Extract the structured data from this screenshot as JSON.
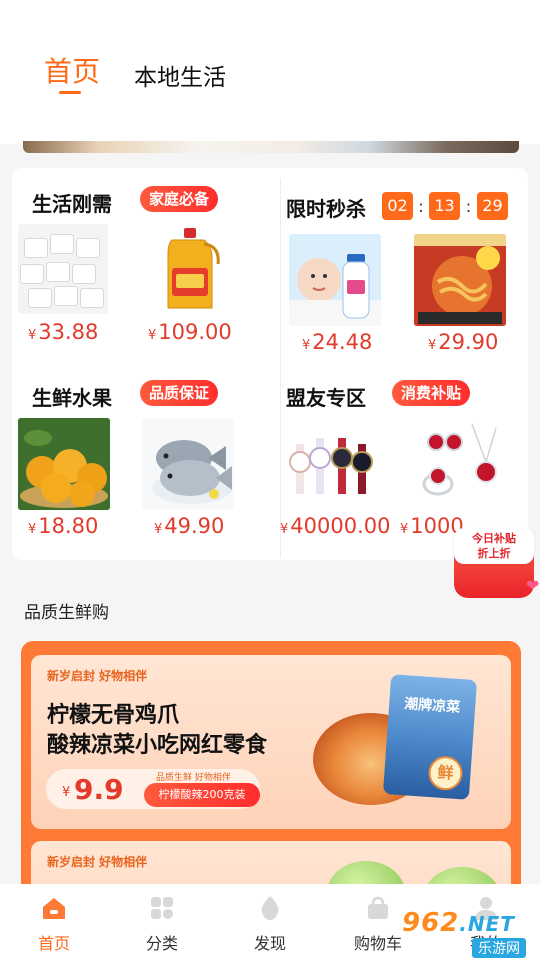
{
  "header": {
    "tabs": [
      {
        "label": "首页",
        "active": true
      },
      {
        "label": "本地生活",
        "active": false
      }
    ],
    "accent": "#ff6a1a"
  },
  "sections": {
    "daily": {
      "title": "生活刚需",
      "badge": "家庭必备",
      "products": [
        {
          "image": "tissue-pack",
          "price": "33.88"
        },
        {
          "image": "cooking-oil",
          "price": "109.00"
        }
      ]
    },
    "flash": {
      "title": "限时秒杀",
      "timer": {
        "hours": "02",
        "minutes": "13",
        "seconds": "29"
      },
      "products": [
        {
          "image": "baby-lotion",
          "price": "24.48"
        },
        {
          "image": "spicy-noodle",
          "price": "29.90"
        }
      ]
    },
    "fresh": {
      "title": "生鲜水果",
      "badge": "品质保证",
      "products": [
        {
          "image": "oranges",
          "price": "18.80"
        },
        {
          "image": "pomfret-fish",
          "price": "49.90"
        }
      ]
    },
    "alliance": {
      "title": "盟友专区",
      "badge": "消费补贴",
      "products": [
        {
          "image": "watches",
          "price": "40000.00"
        },
        {
          "image": "ruby-jewelry",
          "price": "1000"
        }
      ]
    },
    "currency_symbol": "¥"
  },
  "float_promo": {
    "line1": "今日补贴",
    "line2": "折上折"
  },
  "quality": {
    "title": "品质生鲜购",
    "card1": {
      "kicker": "新岁启封 好物相伴",
      "headline1": "柠檬无骨鸡爪",
      "headline2": "酸辣凉菜小吃网红零食",
      "price": "9.9",
      "price_tag": "品质生鲜 好物相伴",
      "button": "柠檬酸辣200克装",
      "bag_title": "潮牌凉菜",
      "bag_badge": "鲜"
    },
    "card2": {
      "kicker": "新岁启封 好物相伴"
    }
  },
  "bottom_nav": {
    "items": [
      {
        "label": "首页",
        "icon": "home-icon",
        "active": true
      },
      {
        "label": "分类",
        "icon": "category-icon",
        "active": false
      },
      {
        "label": "发现",
        "icon": "discover-icon",
        "active": false
      },
      {
        "label": "购物车",
        "icon": "cart-icon",
        "active": false
      },
      {
        "label": "我的",
        "icon": "profile-icon",
        "active": false
      }
    ]
  },
  "watermark": {
    "brand": "962",
    "tld": ".NET",
    "sub": "乐游网"
  }
}
